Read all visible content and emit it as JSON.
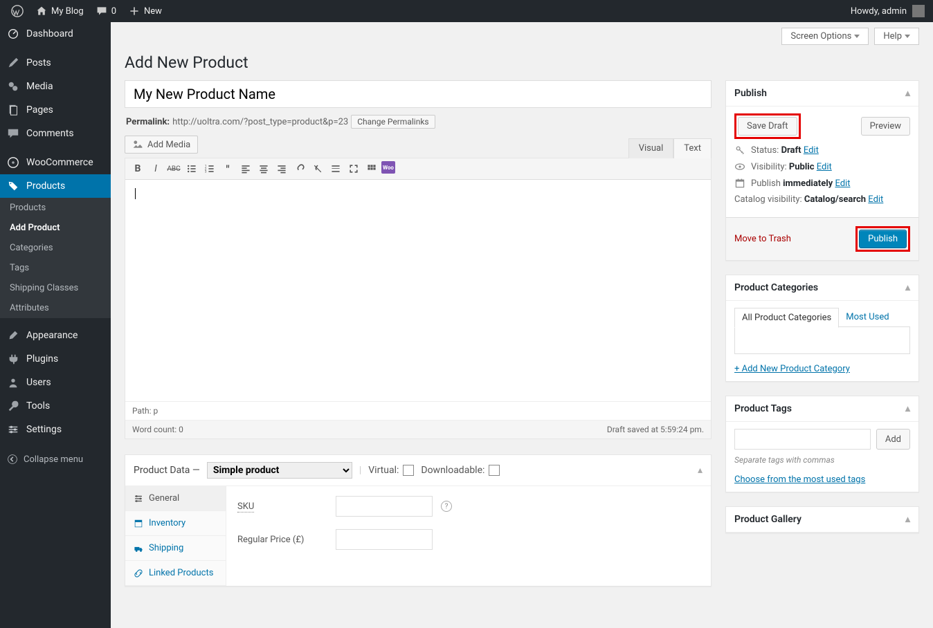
{
  "adminbar": {
    "site_name": "My Blog",
    "comments_count": "0",
    "new_label": "New",
    "howdy": "Howdy, admin"
  },
  "sidebar": {
    "items": [
      {
        "key": "dashboard",
        "label": "Dashboard"
      },
      {
        "key": "posts",
        "label": "Posts"
      },
      {
        "key": "media",
        "label": "Media"
      },
      {
        "key": "pages",
        "label": "Pages"
      },
      {
        "key": "comments",
        "label": "Comments"
      },
      {
        "key": "woocommerce",
        "label": "WooCommerce"
      },
      {
        "key": "products",
        "label": "Products"
      },
      {
        "key": "appearance",
        "label": "Appearance"
      },
      {
        "key": "plugins",
        "label": "Plugins"
      },
      {
        "key": "users",
        "label": "Users"
      },
      {
        "key": "tools",
        "label": "Tools"
      },
      {
        "key": "settings",
        "label": "Settings"
      }
    ],
    "products_submenu": [
      "Products",
      "Add Product",
      "Categories",
      "Tags",
      "Shipping Classes",
      "Attributes"
    ],
    "collapse_label": "Collapse menu"
  },
  "topbtns": {
    "screen_options": "Screen Options",
    "help": "Help"
  },
  "page_title": "Add New Product",
  "title_value": "My New Product Name",
  "permalink": {
    "label": "Permalink:",
    "url": "http://uoltra.com/?post_type=product&p=23",
    "change_btn": "Change Permalinks"
  },
  "editor": {
    "add_media": "Add Media",
    "tabs": {
      "visual": "Visual",
      "text": "Text"
    },
    "path": "Path: p",
    "word_count": "Word count: 0",
    "draft_saved": "Draft saved at 5:59:24 pm."
  },
  "product_data": {
    "head_label": "Product Data —",
    "type_label": "Simple product",
    "virtual_label": "Virtual:",
    "downloadable_label": "Downloadable:",
    "tabs": [
      "General",
      "Inventory",
      "Shipping",
      "Linked Products"
    ],
    "sku_label": "SKU",
    "regular_price_label": "Regular Price (£)"
  },
  "publish": {
    "title": "Publish",
    "save_draft": "Save Draft",
    "preview": "Preview",
    "status_label": "Status:",
    "status_value": "Draft",
    "visibility_label": "Visibility:",
    "visibility_value": "Public",
    "publish_label": "Publish",
    "publish_value": "immediately",
    "catalog_label": "Catalog visibility:",
    "catalog_value": "Catalog/search",
    "edit": "Edit",
    "trash": "Move to Trash",
    "publish_btn": "Publish"
  },
  "categories": {
    "title": "Product Categories",
    "tab_all": "All Product Categories",
    "tab_most": "Most Used",
    "add_new": "+ Add New Product Category"
  },
  "tags": {
    "title": "Product Tags",
    "add_btn": "Add",
    "hint": "Separate tags with commas",
    "choose": "Choose from the most used tags"
  },
  "gallery": {
    "title": "Product Gallery"
  }
}
